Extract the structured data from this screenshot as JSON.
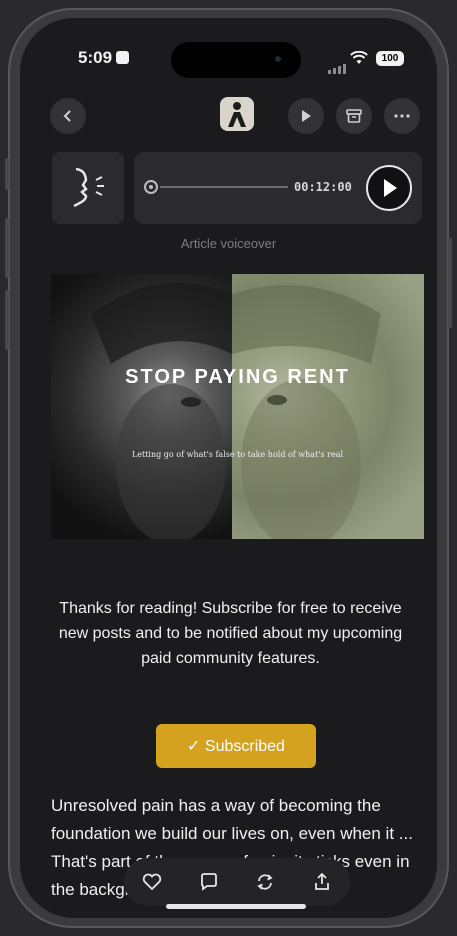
{
  "status_bar": {
    "time": "5:09",
    "battery": "100"
  },
  "player": {
    "duration": "00:12:00",
    "caption": "Article voiceover"
  },
  "hero": {
    "title": "STOP PAYING RENT",
    "subtitle": "Letting go of what's false to take hold of what's real"
  },
  "subscribe": {
    "message": "Thanks for reading! Subscribe for free to receive new posts and to be notified about my upcoming paid community features.",
    "button_label": "✓ Subscribed",
    "button_color": "#d4a21f"
  },
  "article": {
    "paragraph": "Unresolved pain has a way of becoming the foundation we build our lives on, even when it ... That's part of the power of pain; it sticks even in the background. We often convince"
  },
  "action_bar": {
    "icons": [
      "heart-icon",
      "comment-icon",
      "restack-icon",
      "share-icon"
    ]
  },
  "nav": {
    "icons": [
      "back-icon",
      "publication-logo",
      "play-icon",
      "archive-icon",
      "more-icon"
    ]
  }
}
